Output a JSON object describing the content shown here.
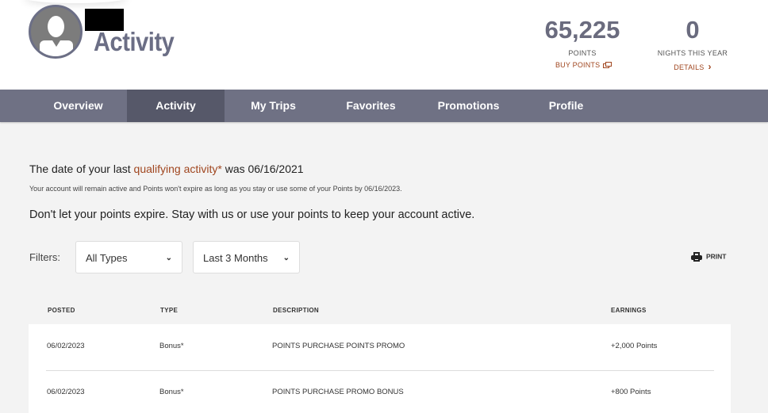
{
  "header": {
    "page_title": "Activity",
    "points": {
      "value": "65,225",
      "label": "POINTS",
      "link": "BUY POINTS"
    },
    "nights": {
      "value": "0",
      "label": "NIGHTS THIS YEAR",
      "link": "DETAILS"
    }
  },
  "nav": {
    "tabs": [
      {
        "label": "Overview",
        "active": false
      },
      {
        "label": "Activity",
        "active": true
      },
      {
        "label": "My Trips",
        "active": false
      },
      {
        "label": "Favorites",
        "active": false
      },
      {
        "label": "Promotions",
        "active": false
      },
      {
        "label": "Profile",
        "active": false
      }
    ]
  },
  "status": {
    "qual_prefix": "The date of your last ",
    "qual_link": "qualifying activity*",
    "qual_suffix": " was 06/16/2021",
    "note": "Your account will remain active and Points won't expire as long as you stay or use some of your Points by 06/16/2023.",
    "cta": "Don't let your points expire. Stay with us or use your points to keep your account active."
  },
  "filters": {
    "label": "Filters:",
    "type_value": "All Types",
    "range_value": "Last 3 Months",
    "print_label": "PRINT"
  },
  "table": {
    "headers": [
      "POSTED",
      "TYPE",
      "DESCRIPTION",
      "EARNINGS"
    ],
    "rows": [
      {
        "posted": "06/02/2023",
        "type": "Bonus*",
        "description": "POINTS PURCHASE POINTS PROMO",
        "earnings": "+2,000 Points"
      },
      {
        "posted": "06/02/2023",
        "type": "Bonus*",
        "description": "POINTS PURCHASE PROMO BONUS",
        "earnings": "+800 Points"
      }
    ]
  },
  "colors": {
    "accent": "#a0461f",
    "nav": "#6f7184",
    "nav_active": "#565869",
    "title": "#6b6e85"
  }
}
